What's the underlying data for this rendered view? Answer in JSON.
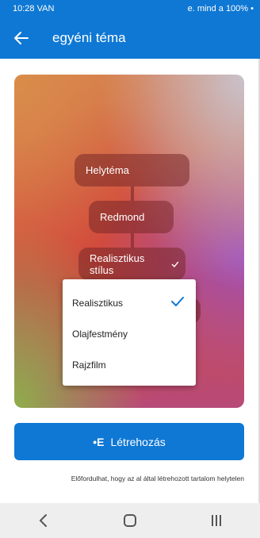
{
  "status_bar": {
    "time": "10:28",
    "carrier": "VAN",
    "right_text": "e. mind a 100%",
    "dot": "•"
  },
  "app_bar": {
    "title": "egyéni téma",
    "back_icon": "arrow-left-icon"
  },
  "preview": {
    "chips": [
      "Helytéma",
      "Redmond",
      "Realisztikus stílus"
    ]
  },
  "style_dropdown": {
    "selected": "Realisztikus",
    "options": [
      "Realisztikus",
      "Olajfestmény",
      "Rajzfilm"
    ]
  },
  "create_button": {
    "icon_text": "•E",
    "label": "Létrehozás"
  },
  "disclaimer": "Előfordulhat, hogy az al által létrehozott tartalom helytelen",
  "colors": {
    "accent": "#0f78d4",
    "navbar": "#eeeeee"
  }
}
